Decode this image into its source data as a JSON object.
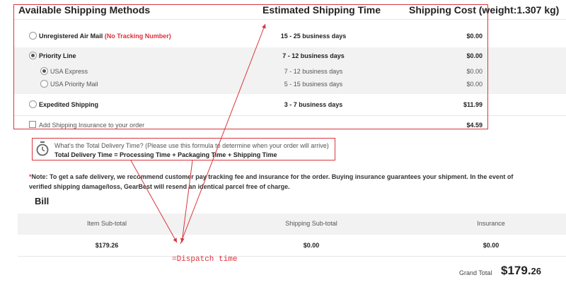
{
  "header": {
    "methods_title": "Available Shipping Methods",
    "time_title": "Estimated Shipping Time",
    "cost_title": "Shipping Cost (weight:1.307 kg)"
  },
  "methods": [
    {
      "name": "Unregistered Air Mail",
      "note": "(No Tracking Number)",
      "time": "15 - 25 business days",
      "cost": "$0.00",
      "selected": false
    },
    {
      "name": "Priority Line",
      "time": "7 - 12 business days",
      "cost": "$0.00",
      "selected": true
    },
    {
      "name": "USA Express",
      "time": "7 - 12 business days",
      "cost": "$0.00",
      "selected": true
    },
    {
      "name": "USA Priority Mail",
      "time": "5 - 15 business days",
      "cost": "$0.00",
      "selected": false
    },
    {
      "name": "Expedited Shipping",
      "time": "3 - 7 business days",
      "cost": "$11.99",
      "selected": false
    }
  ],
  "insurance": {
    "label": "Add Shipping Insurance to your order",
    "cost": "$4.59",
    "checked": false
  },
  "delivery": {
    "question": "What's the Total Delivery Time? (Please use this formula to determine when your order will arrive)",
    "formula": "Total Delivery Time = Processing Time + Packaging Time + Shipping Time"
  },
  "note": {
    "asterisk": "*",
    "text": "Note: To get a safe delivery, we recommend customer pay tracking fee and insurance for the order. Buying insurance guarantees your shipment. In the event of verified shipping damage/loss, GearBest will resend an identical parcel free of charge."
  },
  "bill": {
    "title": "Bill",
    "headers": [
      "Item Sub-total",
      "Shipping Sub-total",
      "Insurance"
    ],
    "values": [
      "$179.26",
      "$0.00",
      "$0.00"
    ],
    "grand_total_label": "Grand Total",
    "grand_total_main": "$179.",
    "grand_total_cents": "26"
  },
  "annotation": {
    "text": "=Dispatch time",
    "color": "#e0303a"
  },
  "icons": {
    "clock": "clock-icon"
  }
}
